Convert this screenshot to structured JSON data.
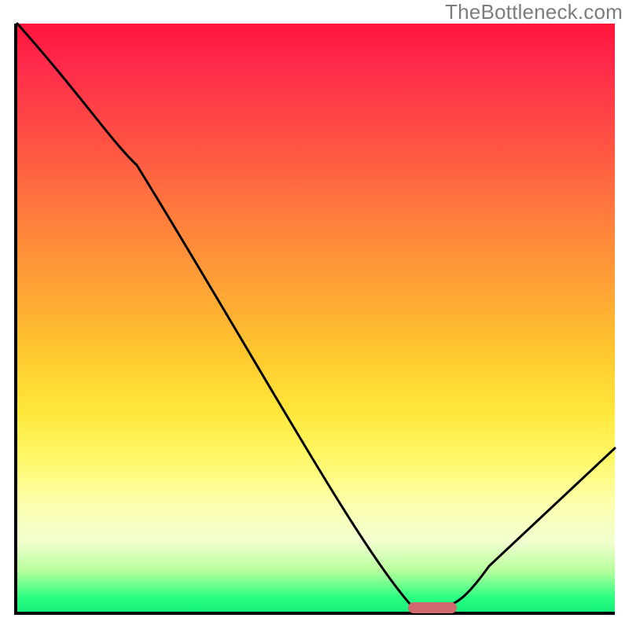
{
  "watermark": "TheBottleneck.com",
  "chart_data": {
    "type": "line",
    "title": "",
    "xlabel": "",
    "ylabel": "",
    "xlim": [
      0,
      100
    ],
    "ylim": [
      0,
      100
    ],
    "x": [
      0,
      20,
      66,
      72,
      76,
      100
    ],
    "values": [
      100,
      76,
      1,
      1,
      2,
      28
    ],
    "marker": {
      "x_center": 69,
      "width": 8,
      "y": 0.8,
      "color": "#d1696e"
    },
    "gradient_stops": [
      {
        "pos": 0,
        "color": "#ff143a"
      },
      {
        "pos": 0.07,
        "color": "#ff2a4a"
      },
      {
        "pos": 0.2,
        "color": "#ff5144"
      },
      {
        "pos": 0.32,
        "color": "#ff7a3d"
      },
      {
        "pos": 0.44,
        "color": "#ffa036"
      },
      {
        "pos": 0.56,
        "color": "#ffc72e"
      },
      {
        "pos": 0.66,
        "color": "#ffe83a"
      },
      {
        "pos": 0.74,
        "color": "#fff86a"
      },
      {
        "pos": 0.82,
        "color": "#fcffb0"
      },
      {
        "pos": 0.88,
        "color": "#f2ffd0"
      },
      {
        "pos": 0.93,
        "color": "#b8ff9e"
      },
      {
        "pos": 0.975,
        "color": "#2eff82"
      },
      {
        "pos": 1.0,
        "color": "#14f07c"
      }
    ]
  }
}
